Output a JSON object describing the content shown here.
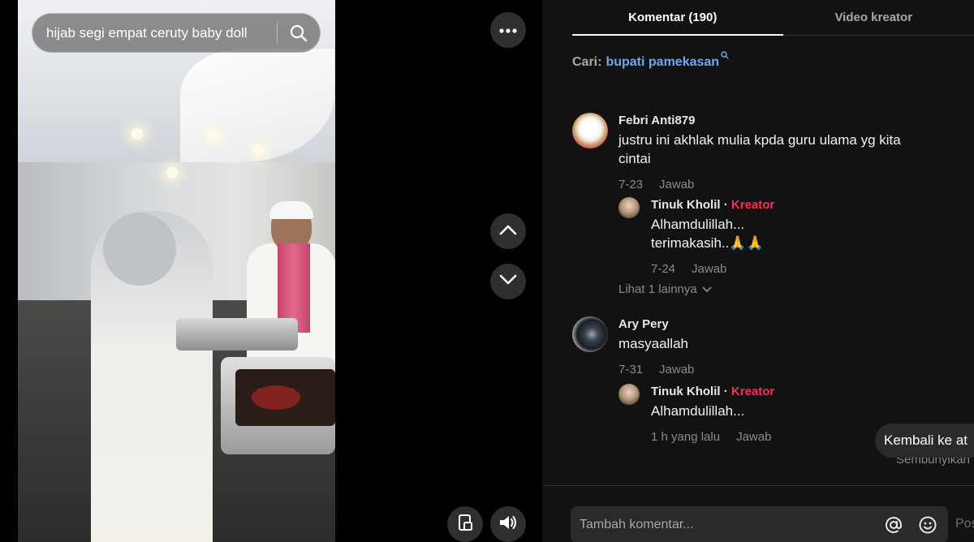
{
  "video": {
    "search_query": "hijab segi empat ceruty baby doll"
  },
  "tabs": [
    {
      "label": "Komentar (190)",
      "active": true
    },
    {
      "label": "Video kreator",
      "active": false
    }
  ],
  "search_suggestion": {
    "label": "Cari:",
    "query": "bupati pamekasan"
  },
  "comments": [
    {
      "user": "Febri Anti879",
      "text": "justru ini akhlak mulia kpda guru ulama yg kita cintai",
      "date": "7-23",
      "reply_label": "Jawab",
      "replies": [
        {
          "user": "Tinuk Kholil",
          "badge": "Kreator",
          "separator": "·",
          "text_line1": "Alhamdulillah...",
          "text_line2": "terimakasih..🙏🙏",
          "date": "7-24",
          "reply_label": "Jawab"
        }
      ],
      "see_more": "Lihat 1 lainnya"
    },
    {
      "user": "Ary Pery",
      "text": "masyaallah",
      "date": "7-31",
      "reply_label": "Jawab",
      "replies": [
        {
          "user": "Tinuk Kholil",
          "badge": "Kreator",
          "separator": "·",
          "text": "Alhamdulillah...",
          "date": "1 h yang lalu",
          "reply_label": "Jawab"
        }
      ]
    }
  ],
  "back_to_top": "Kembali ke at",
  "hide_label": "Sembunyikan",
  "composer": {
    "placeholder": "Tambah komentar...",
    "post_label": "Pos"
  },
  "colors": {
    "accent_creator": "#fe2c55",
    "link": "#6fa8f0",
    "background": "#121212"
  },
  "icons": [
    "search-icon",
    "more-icon",
    "chevron-up-icon",
    "chevron-down-icon",
    "miniplayer-icon",
    "volume-icon",
    "mention-icon",
    "emoji-icon"
  ]
}
